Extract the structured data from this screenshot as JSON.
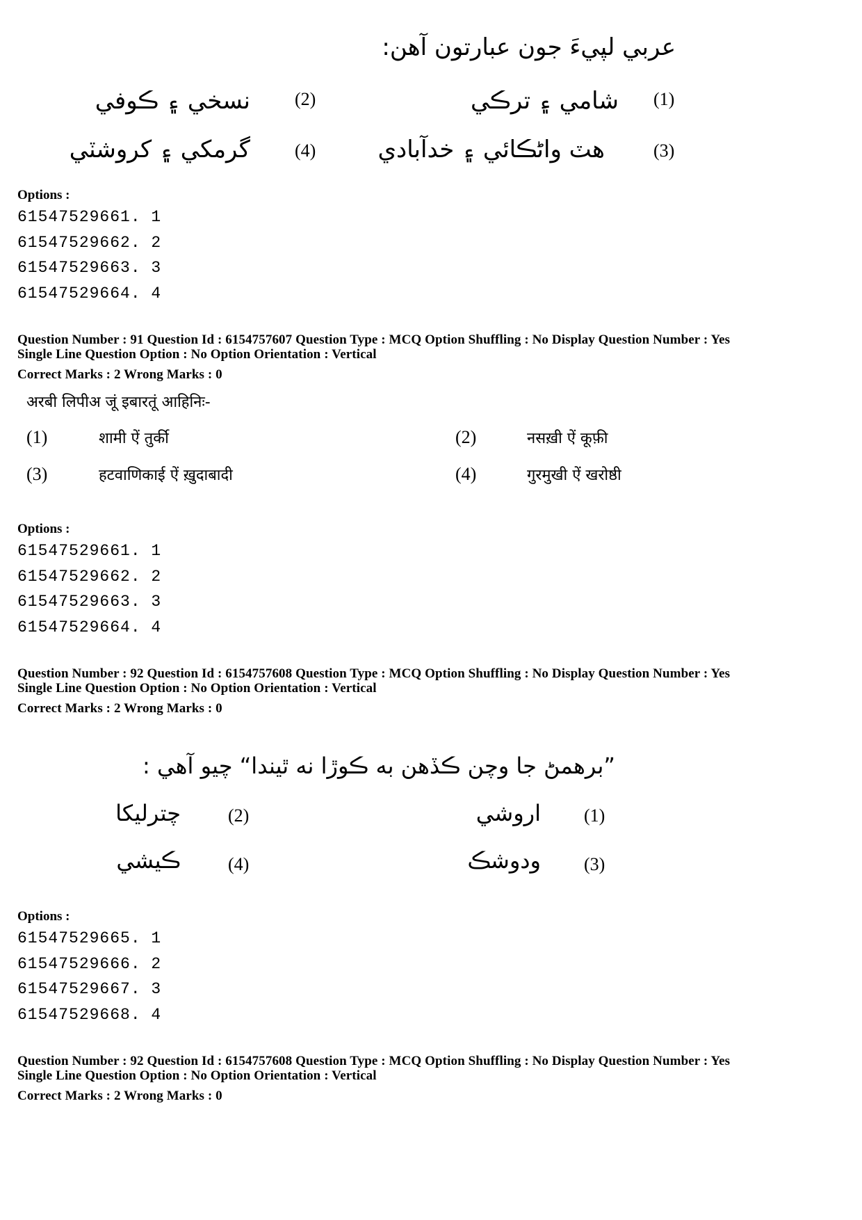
{
  "block0": {
    "question_sindhi": "عربي لپيءَ جون عبارتون آهن:",
    "choices": [
      {
        "num": "(1)",
        "text": "شامي ۽ ترڪي"
      },
      {
        "num": "(2)",
        "text": "نسخي ۽ ڪوفي"
      },
      {
        "num": "(3)",
        "text": "هٽ واڻڪائي ۽ خدآبادي"
      },
      {
        "num": "(4)",
        "text": "گرمکي ۽ کروشٽي"
      }
    ],
    "options_label": "Options :",
    "options": [
      "61547529661. 1",
      "61547529662. 2",
      "61547529663. 3",
      "61547529664. 4"
    ]
  },
  "q91": {
    "meta_line1": "Question Number : 91  Question Id : 6154757607  Question Type : MCQ  Option Shuffling : No  Display Question Number : Yes",
    "meta_line2": "Single Line Question Option : No  Option Orientation : Vertical",
    "marks": "Correct Marks : 2  Wrong Marks : 0",
    "question_hindi": "अरबी लिपीअ जूं इबारतूं आहिनिः-",
    "choices": [
      {
        "num": "(1)",
        "text": "शामी ऐं तुर्की"
      },
      {
        "num": "(2)",
        "text": "नसख़ी ऐं कूफ़ी"
      },
      {
        "num": "(3)",
        "text": "हटवाणिकाई ऐं ख़ुदाबादी"
      },
      {
        "num": "(4)",
        "text": "गुरमुखी ऐं खरोष्ठी"
      }
    ],
    "options_label": "Options :",
    "options": [
      "61547529661. 1",
      "61547529662. 2",
      "61547529663. 3",
      "61547529664. 4"
    ]
  },
  "q92": {
    "meta_line1": "Question Number : 92  Question Id : 6154757608  Question Type : MCQ  Option Shuffling : No  Display Question Number : Yes",
    "meta_line2": "Single Line Question Option : No  Option Orientation : Vertical",
    "marks": "Correct Marks : 2  Wrong Marks : 0",
    "question_sindhi": "”برهمڻ جا وچن ڪڏهن به ڪوڙا نه ٿيندا“ چيو آهي :",
    "choices": [
      {
        "num": "(1)",
        "text": "اروشي"
      },
      {
        "num": "(2)",
        "text": "چترليکا"
      },
      {
        "num": "(3)",
        "text": "ودوشڪ"
      },
      {
        "num": "(4)",
        "text": "ڪيشي"
      }
    ],
    "options_label": "Options :",
    "options": [
      "61547529665. 1",
      "61547529666. 2",
      "61547529667. 3",
      "61547529668. 4"
    ]
  },
  "q92_repeat": {
    "meta_line1": "Question Number : 92  Question Id : 6154757608  Question Type : MCQ  Option Shuffling : No  Display Question Number : Yes",
    "meta_line2": "Single Line Question Option : No  Option Orientation : Vertical",
    "marks": "Correct Marks : 2  Wrong Marks : 0"
  }
}
